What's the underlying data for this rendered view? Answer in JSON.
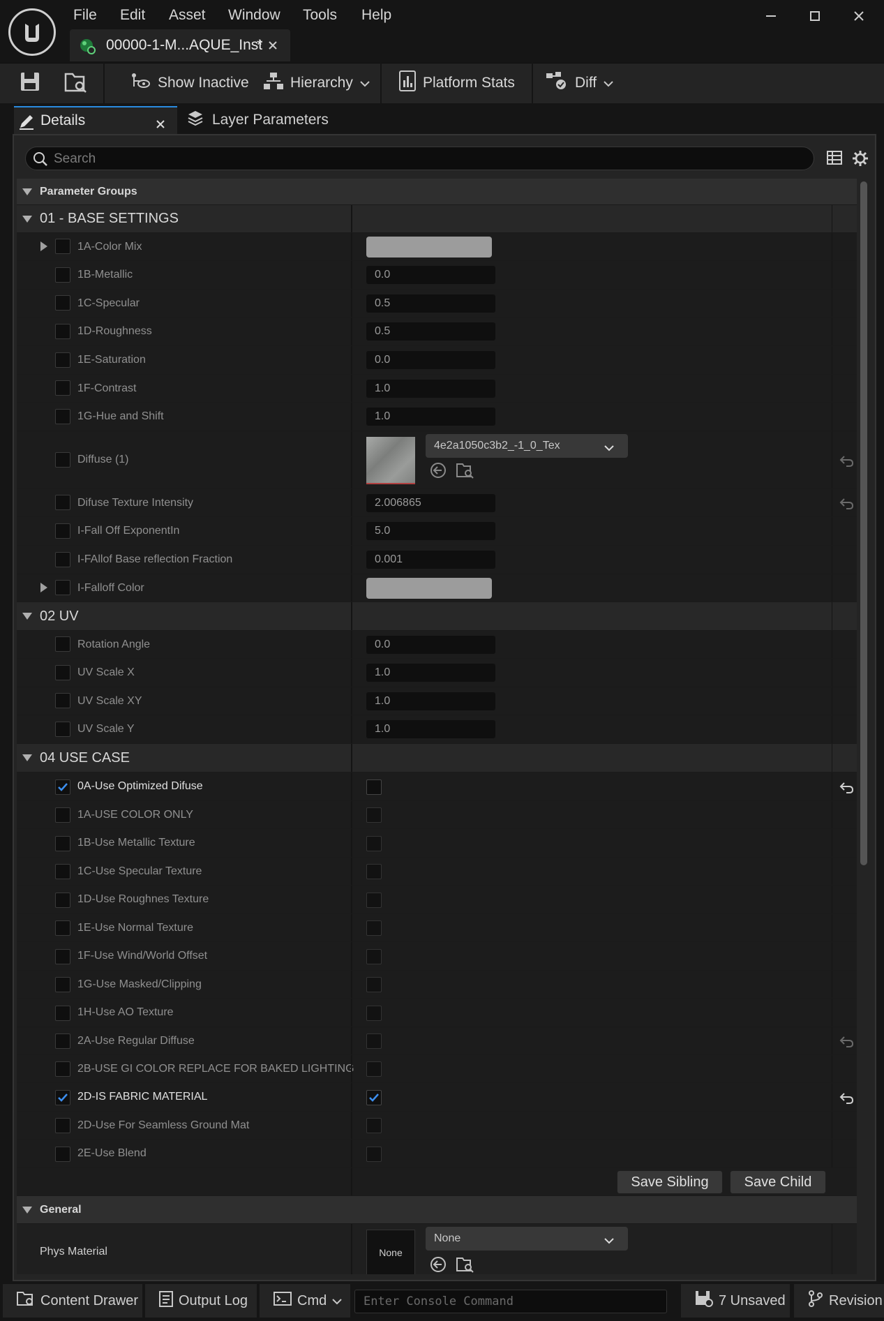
{
  "app": {
    "menu": [
      "File",
      "Edit",
      "Asset",
      "Window",
      "Tools",
      "Help"
    ],
    "document_tab": "00000-1-M...AQUE_Inst",
    "document_modified": "*"
  },
  "toolbar": {
    "show_inactive": "Show Inactive",
    "hierarchy": "Hierarchy",
    "platform_stats": "Platform Stats",
    "diff": "Diff"
  },
  "panel_tabs": {
    "details": "Details",
    "layer_parameters": "Layer Parameters"
  },
  "search": {
    "placeholder": "Search"
  },
  "sections": {
    "parameter_groups": "Parameter Groups",
    "base_settings": "01 - BASE SETTINGS",
    "uv": "02 UV",
    "use_case": "04 USE CASE",
    "general": "General"
  },
  "base_settings": {
    "color_mix": "1A-Color Mix",
    "metallic": {
      "label": "1B-Metallic",
      "value": "0.0"
    },
    "specular": {
      "label": "1C-Specular",
      "value": "0.5"
    },
    "roughness": {
      "label": "1D-Roughness",
      "value": "0.5"
    },
    "saturation": {
      "label": "1E-Saturation",
      "value": "0.0"
    },
    "contrast": {
      "label": "1F-Contrast",
      "value": "1.0"
    },
    "hue_shift": {
      "label": "1G-Hue and Shift",
      "value": "1.0"
    },
    "diffuse": {
      "label": "Diffuse (1)",
      "texture": "4e2a1050c3b2_-1_0_Tex"
    },
    "diffuse_intensity": {
      "label": "Difuse Texture Intensity",
      "value": "2.006865"
    },
    "falloff_exp": {
      "label": "I-Fall Off ExponentIn",
      "value": "5.0"
    },
    "falloff_base": {
      "label": "I-FAllof Base reflection Fraction",
      "value": "0.001"
    },
    "falloff_color": "I-Falloff Color"
  },
  "uv": {
    "rotation": {
      "label": "Rotation Angle",
      "value": "0.0"
    },
    "scale_x": {
      "label": "UV Scale X",
      "value": "1.0"
    },
    "scale_xy": {
      "label": "UV Scale XY",
      "value": "1.0"
    },
    "scale_y": {
      "label": "UV Scale Y",
      "value": "1.0"
    }
  },
  "use_case": [
    {
      "label": "0A-Use Optimized Difuse",
      "enabled": true,
      "value": false,
      "reset": true
    },
    {
      "label": "1A-USE COLOR ONLY",
      "enabled": false,
      "value": false,
      "reset": false
    },
    {
      "label": "1B-Use Metallic Texture",
      "enabled": false,
      "value": false,
      "reset": false
    },
    {
      "label": "1C-Use Specular Texture",
      "enabled": false,
      "value": false,
      "reset": false
    },
    {
      "label": "1D-Use Roughnes Texture",
      "enabled": false,
      "value": false,
      "reset": false
    },
    {
      "label": "1E-Use Normal Texture",
      "enabled": false,
      "value": false,
      "reset": false
    },
    {
      "label": "1F-Use Wind/World Offset",
      "enabled": false,
      "value": false,
      "reset": false
    },
    {
      "label": "1G-Use Masked/Clipping",
      "enabled": false,
      "value": false,
      "reset": false
    },
    {
      "label": "1H-Use AO Texture",
      "enabled": false,
      "value": false,
      "reset": false
    },
    {
      "label": "2A-Use Regular Diffuse",
      "enabled": false,
      "value": false,
      "reset": true
    },
    {
      "label": "2B-USE GI COLOR REPLACE FOR BAKED LIGHTING",
      "enabled": false,
      "value": false,
      "reset": false
    },
    {
      "label": "2D-IS FABRIC MATERIAL",
      "enabled": true,
      "value": true,
      "reset": true
    },
    {
      "label": "2D-Use For Seamless Ground Mat",
      "enabled": false,
      "value": false,
      "reset": false
    },
    {
      "label": "2E-Use Blend",
      "enabled": false,
      "value": false,
      "reset": false
    }
  ],
  "buttons": {
    "save_sibling": "Save Sibling",
    "save_child": "Save Child"
  },
  "general": {
    "phys_material": {
      "label": "Phys Material",
      "thumb": "None",
      "value": "None"
    }
  },
  "statusbar": {
    "content_drawer": "Content Drawer",
    "output_log": "Output Log",
    "cmd": "Cmd",
    "console_placeholder": "Enter Console Command",
    "unsaved": "7 Unsaved",
    "revision": "Revision"
  },
  "colors": {
    "accent": "#2a8be0",
    "check": "#3c8ff0",
    "panel": "#242424",
    "row": "#1c1c1c"
  }
}
